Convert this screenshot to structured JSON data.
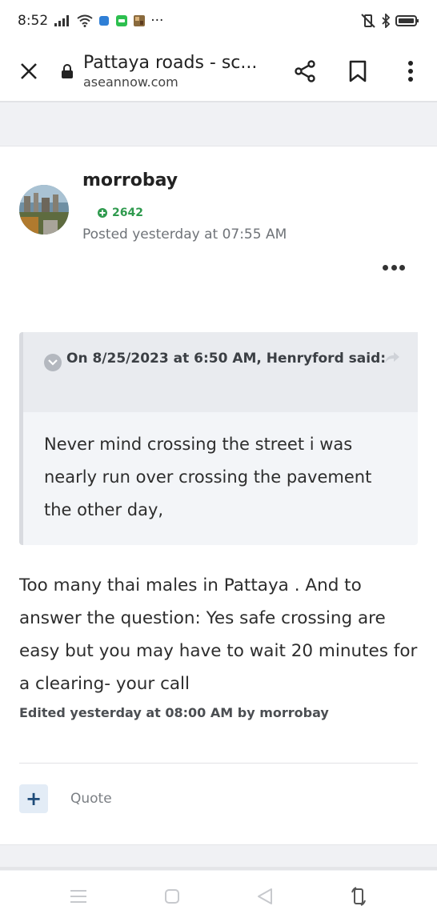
{
  "status_bar": {
    "time": "8:52",
    "dots": "···"
  },
  "toolbar": {
    "title": "Pattaya roads - sc...",
    "url": "aseannow.com",
    "icons": [
      "close-icon",
      "lock-icon",
      "share-icon",
      "bookmark-icon",
      "more-vertical-icon"
    ]
  },
  "post": {
    "author": "morrobay",
    "reputation": "2642",
    "posted": "Posted yesterday at 07:55 AM",
    "quote": {
      "citation": "On 8/25/2023 at 6:50 AM, Henryford said:",
      "text": "Never mind crossing the street i was nearly run over crossing the pavement the other day,"
    },
    "body": "Too many thai males in Pattaya . And to answer the question: Yes safe crossing are easy but you may have to wait 20 minutes for a clearing- your call",
    "edited": "Edited yesterday at 08:00 AM by morrobay",
    "actions": {
      "plus": "+",
      "quote_label": "Quote"
    }
  },
  "colors": {
    "reputation_green": "#2f9a4e",
    "plus_button_bg": "#e3ecf6",
    "plus_button_fg": "#1f4c79"
  }
}
